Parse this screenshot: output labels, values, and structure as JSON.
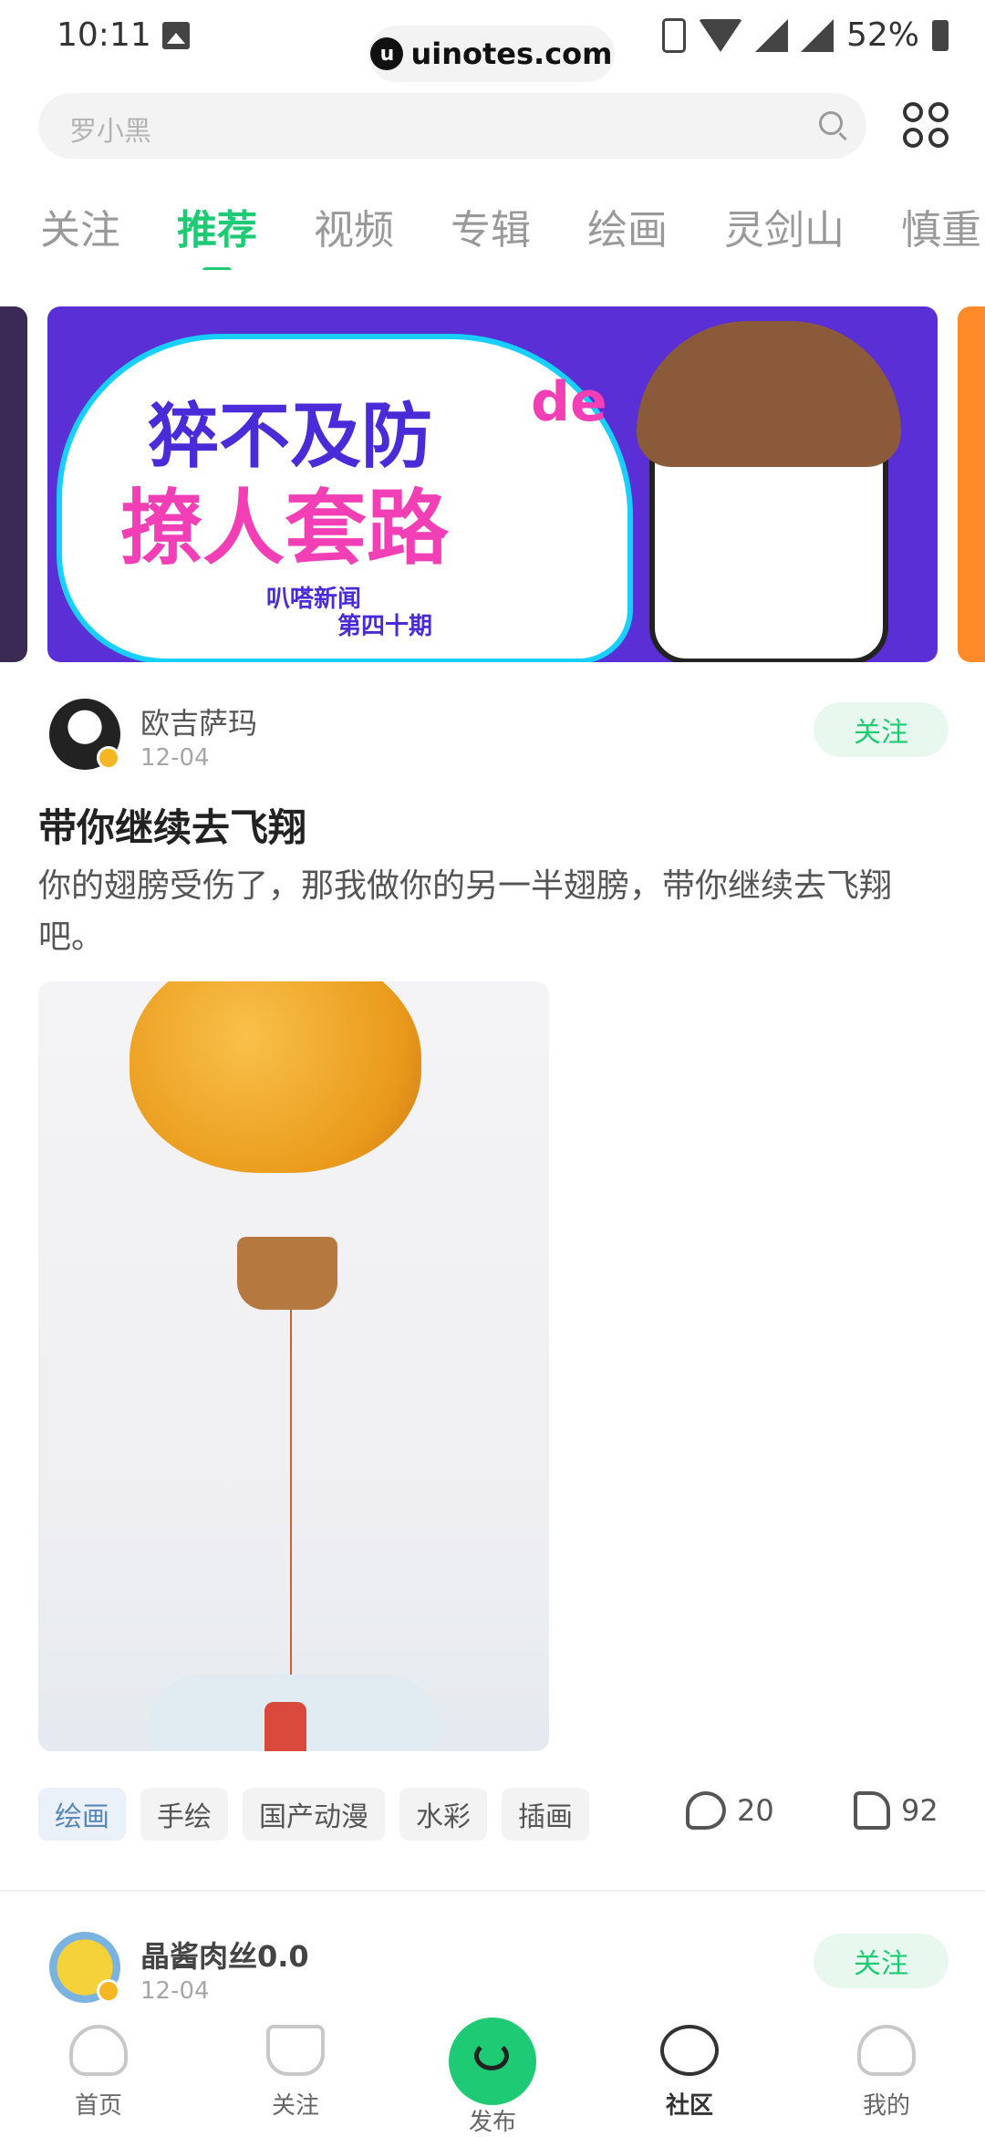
{
  "status_bar": {
    "time": "10:11",
    "battery": "52%"
  },
  "watermark": {
    "text": "uinotes.com"
  },
  "search": {
    "placeholder": "罗小黑"
  },
  "tabs": [
    {
      "label": "关注"
    },
    {
      "label": "推荐"
    },
    {
      "label": "视频"
    },
    {
      "label": "专辑"
    },
    {
      "label": "绘画"
    },
    {
      "label": "灵剑山"
    },
    {
      "label": "慎重"
    }
  ],
  "banner": {
    "title_line1": "猝不及防",
    "title_mark": "de",
    "title_line2": "撩人套路",
    "subtitle_line1": "叭嗒新闻",
    "subtitle_line2": "第四十期",
    "active_dot": 1,
    "dot_count": 4
  },
  "post1": {
    "author": "欧吉萨玛",
    "date": "12-04",
    "follow_label": "关注",
    "title": "带你继续去飞翔",
    "body": "你的翅膀受伤了，那我做你的另一半翅膀，带你继续去飞翔吧。",
    "tags": [
      "绘画",
      "手绘",
      "国产动漫",
      "水彩",
      "插画"
    ],
    "comments": "20",
    "likes": "92"
  },
  "post2": {
    "author": "晶酱肉丝0.0",
    "date": "12-04",
    "follow_label": "关注"
  },
  "bottom_nav": [
    {
      "label": "首页",
      "icon": "home-icon"
    },
    {
      "label": "关注",
      "icon": "follow-pot-icon"
    },
    {
      "label": "发布",
      "icon": "publish-icon"
    },
    {
      "label": "社区",
      "icon": "community-icon"
    },
    {
      "label": "我的",
      "icon": "profile-icon"
    }
  ],
  "colors": {
    "accent": "#1ecb74",
    "banner_bg": "#5a2fd6",
    "banner_pink": "#f23fb6"
  }
}
